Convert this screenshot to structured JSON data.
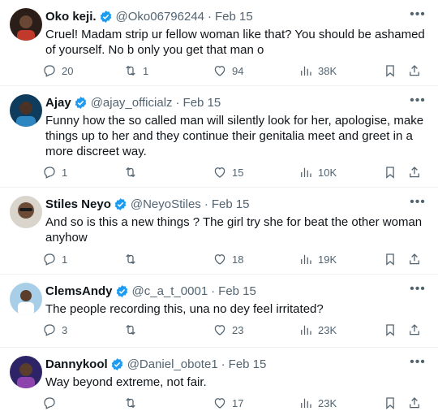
{
  "tweets": [
    {
      "name": "Oko keji.",
      "handle": "@Oko06796244",
      "date": "Feb 15",
      "text": "Cruel! Madam strip ur fellow woman like that? You should be ashamed of yourself. No b only you get that man o",
      "replies": "20",
      "retweets": "1",
      "likes": "94",
      "views": "38K",
      "avatar_color": "#3a2a22"
    },
    {
      "name": "Ajay",
      "handle": "@ajay_officialz",
      "date": "Feb 15",
      "text": "Funny how the so called man will silently look for her, apologise, make things up to her and they continue their genitalia meet and greet in a more discreet way.",
      "replies": "1",
      "retweets": "",
      "likes": "15",
      "views": "10K",
      "avatar_color": "#1c5a8a"
    },
    {
      "name": "Stiles Neyo",
      "handle": "@NeyoStiles",
      "date": "Feb 15",
      "text": "And so is this a new things ? The girl try she for beat the other woman anyhow",
      "replies": "1",
      "retweets": "",
      "likes": "18",
      "views": "19K",
      "avatar_color": "#6b4a36"
    },
    {
      "name": "ClemsAndy",
      "handle": "@c_a_t_0001",
      "date": "Feb 15",
      "text": "The people recording this, una no dey feel irritated?",
      "replies": "3",
      "retweets": "",
      "likes": "23",
      "views": "23K",
      "avatar_color": "#7fb3d5"
    },
    {
      "name": "Dannykool",
      "handle": "@Daniel_obote1",
      "date": "Feb 15",
      "text": "Way beyond extreme, not fair.",
      "replies": "",
      "retweets": "",
      "likes": "17",
      "views": "23K",
      "avatar_color": "#4a3a8a"
    }
  ],
  "accent": "#1d9bf0"
}
